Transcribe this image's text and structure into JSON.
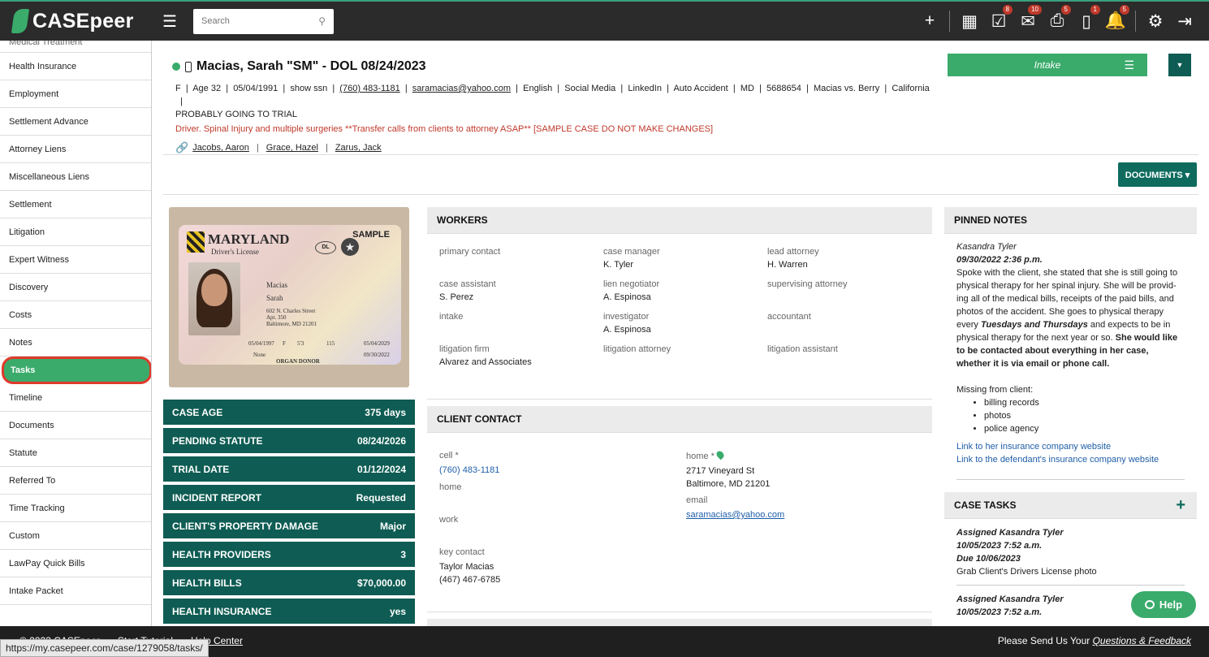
{
  "header": {
    "brand": "CASEpeer",
    "search_placeholder": "Search",
    "icons": [
      {
        "name": "plus-icon",
        "glyph": "+",
        "badge": ""
      },
      {
        "name": "calendar-icon",
        "glyph": "▦",
        "badge": ""
      },
      {
        "name": "tasks-check-icon",
        "glyph": "☑",
        "badge": "8"
      },
      {
        "name": "mail-icon",
        "glyph": "✉",
        "badge": "10"
      },
      {
        "name": "inbox-icon",
        "glyph": "⎙",
        "badge": "5"
      },
      {
        "name": "phone-icon",
        "glyph": "▯",
        "badge": "1"
      },
      {
        "name": "bell-icon",
        "glyph": "🔔",
        "badge": "5"
      },
      {
        "name": "gear-icon",
        "glyph": "⚙",
        "badge": ""
      },
      {
        "name": "logout-icon",
        "glyph": "⇥",
        "badge": ""
      }
    ]
  },
  "sidebar": {
    "cut_item": "Medical Treatment",
    "items": [
      "Health Insurance",
      "Employment",
      "Settlement Advance",
      "Attorney Liens",
      "Miscellaneous Liens",
      "Settlement",
      "Litigation",
      "Expert Witness",
      "Discovery",
      "Costs",
      "Notes",
      "Tasks",
      "Timeline",
      "Documents",
      "Statute",
      "Referred To",
      "Time Tracking",
      "Custom",
      "LawPay Quick Bills",
      "Intake Packet"
    ],
    "active": "Tasks"
  },
  "case": {
    "title": "Macias, Sarah \"SM\" - DOL 08/24/2023",
    "meta_items": [
      "F",
      "Age 32",
      "05/04/1991",
      "show ssn",
      "(760) 483-1181",
      "saramacias@yahoo.com",
      "English",
      "Social Media",
      "LinkedIn",
      "Auto Accident",
      "MD",
      "5688654",
      "Macias vs. Berry",
      "California"
    ],
    "meta_line2": "PROBABLY GOING TO TRIAL",
    "red_note": "Driver. Spinal Injury and multiple surgeries **Transfer calls from clients to attorney ASAP** [SAMPLE CASE DO NOT MAKE CHANGES]",
    "linked": [
      "Jacobs, Aaron",
      "Grace, Hazel",
      "Zarus, Jack"
    ],
    "status_button": "Intake",
    "documents_button": "DOCUMENTS ▾"
  },
  "license": {
    "state": "MARYLAND",
    "sub": "Driver's License",
    "sample": "SAMPLE",
    "dl": "DL",
    "family_name": "Macias",
    "given_name": "Sarah",
    "address1": "602 N. Charles Street",
    "address2": "Apt. 350",
    "address3": "Baltimore, MD 21201",
    "dob": "05/04/1997",
    "sex": "F",
    "height": "5'3",
    "weight": "115",
    "issue": "05/04/2029",
    "expires": "09/30/2022",
    "restrictions": "None",
    "donor": "ORGAN DONOR"
  },
  "stats": [
    {
      "label": "CASE AGE",
      "value": "375 days"
    },
    {
      "label": "PENDING STATUTE",
      "value": "08/24/2026"
    },
    {
      "label": "TRIAL DATE",
      "value": "01/12/2024"
    },
    {
      "label": "INCIDENT REPORT",
      "value": "Requested"
    },
    {
      "label": "CLIENT'S PROPERTY DAMAGE",
      "value": "Major"
    },
    {
      "label": "HEALTH PROVIDERS",
      "value": "3"
    },
    {
      "label": "HEALTH BILLS",
      "value": "$70,000.00"
    },
    {
      "label": "HEALTH INSURANCE",
      "value": "yes"
    }
  ],
  "workers": {
    "title": "WORKERS",
    "cells": [
      {
        "label": "primary contact",
        "value": ""
      },
      {
        "label": "case manager",
        "value": "K. Tyler"
      },
      {
        "label": "lead attorney",
        "value": "H. Warren"
      },
      {
        "label": "case assistant",
        "value": "S. Perez"
      },
      {
        "label": "lien negotiator",
        "value": "A. Espinosa"
      },
      {
        "label": "supervising attorney",
        "value": ""
      },
      {
        "label": "intake",
        "value": ""
      },
      {
        "label": "investigator",
        "value": "A. Espinosa"
      },
      {
        "label": "accountant",
        "value": ""
      },
      {
        "label": "litigation firm",
        "value": "Alvarez and Associates"
      },
      {
        "label": "litigation attorney",
        "value": ""
      },
      {
        "label": "litigation assistant",
        "value": ""
      }
    ]
  },
  "contact": {
    "title": "CLIENT CONTACT",
    "cell_label": "cell *",
    "cell_value": "(760) 483-1181",
    "home_label": "home",
    "work_label": "work",
    "key_label": "key contact",
    "key_name": "Taylor Macias",
    "key_phone": "(467) 467-6785",
    "home_addr_label": "home *",
    "addr1": "2717 Vineyard St",
    "addr2": "Baltimore, MD 21201",
    "email_label": "email",
    "email_value": "saramacias@yahoo.com"
  },
  "pinned": {
    "title": "PINNED NOTES",
    "author": "Kasandra Tyler",
    "date": "09/30/2022 2:36 p.m.",
    "text1": "Spoke with the client, she stated that she is still going to physical therapy for her spinal injury. She will be provid- ing all of the medical bills, receipts of the paid bills, and photos of the accident. She goes to physical therapy every ",
    "text_italic": "Tuesdays and Thursdays",
    "text2": " and expects to be in physical therapy for the next year or so. ",
    "text_bold": "She would like to be contacted about everything in her case, whether it is via email or phone call.",
    "missing_label": "Missing from client:",
    "missing": [
      "billing records",
      "photos",
      "police agency"
    ],
    "link1": "Link to her insurance company website",
    "link2": "Link to the defendant's insurance company website"
  },
  "tasks": {
    "title": "CASE TASKS",
    "items": [
      {
        "assigned": "Assigned Kasandra Tyler",
        "date": "10/05/2023 7:52 a.m.",
        "due": "Due 10/06/2023",
        "text": "Grab Client's Drivers License photo"
      },
      {
        "assigned": "Assigned Kasandra Tyler",
        "date": "10/05/2023 7:52 a.m.",
        "due": "",
        "text": ""
      }
    ]
  },
  "help": {
    "label": "Help"
  },
  "footer": {
    "copyright": "© 2023 CASEpeer",
    "tutorial": "Start Tutorial",
    "help_center": "Help Center",
    "feedback_prefix": "Please Send Us Your ",
    "feedback_link": "Questions & Feedback"
  },
  "status_url": "https://my.casepeer.com/case/1279058/tasks/"
}
